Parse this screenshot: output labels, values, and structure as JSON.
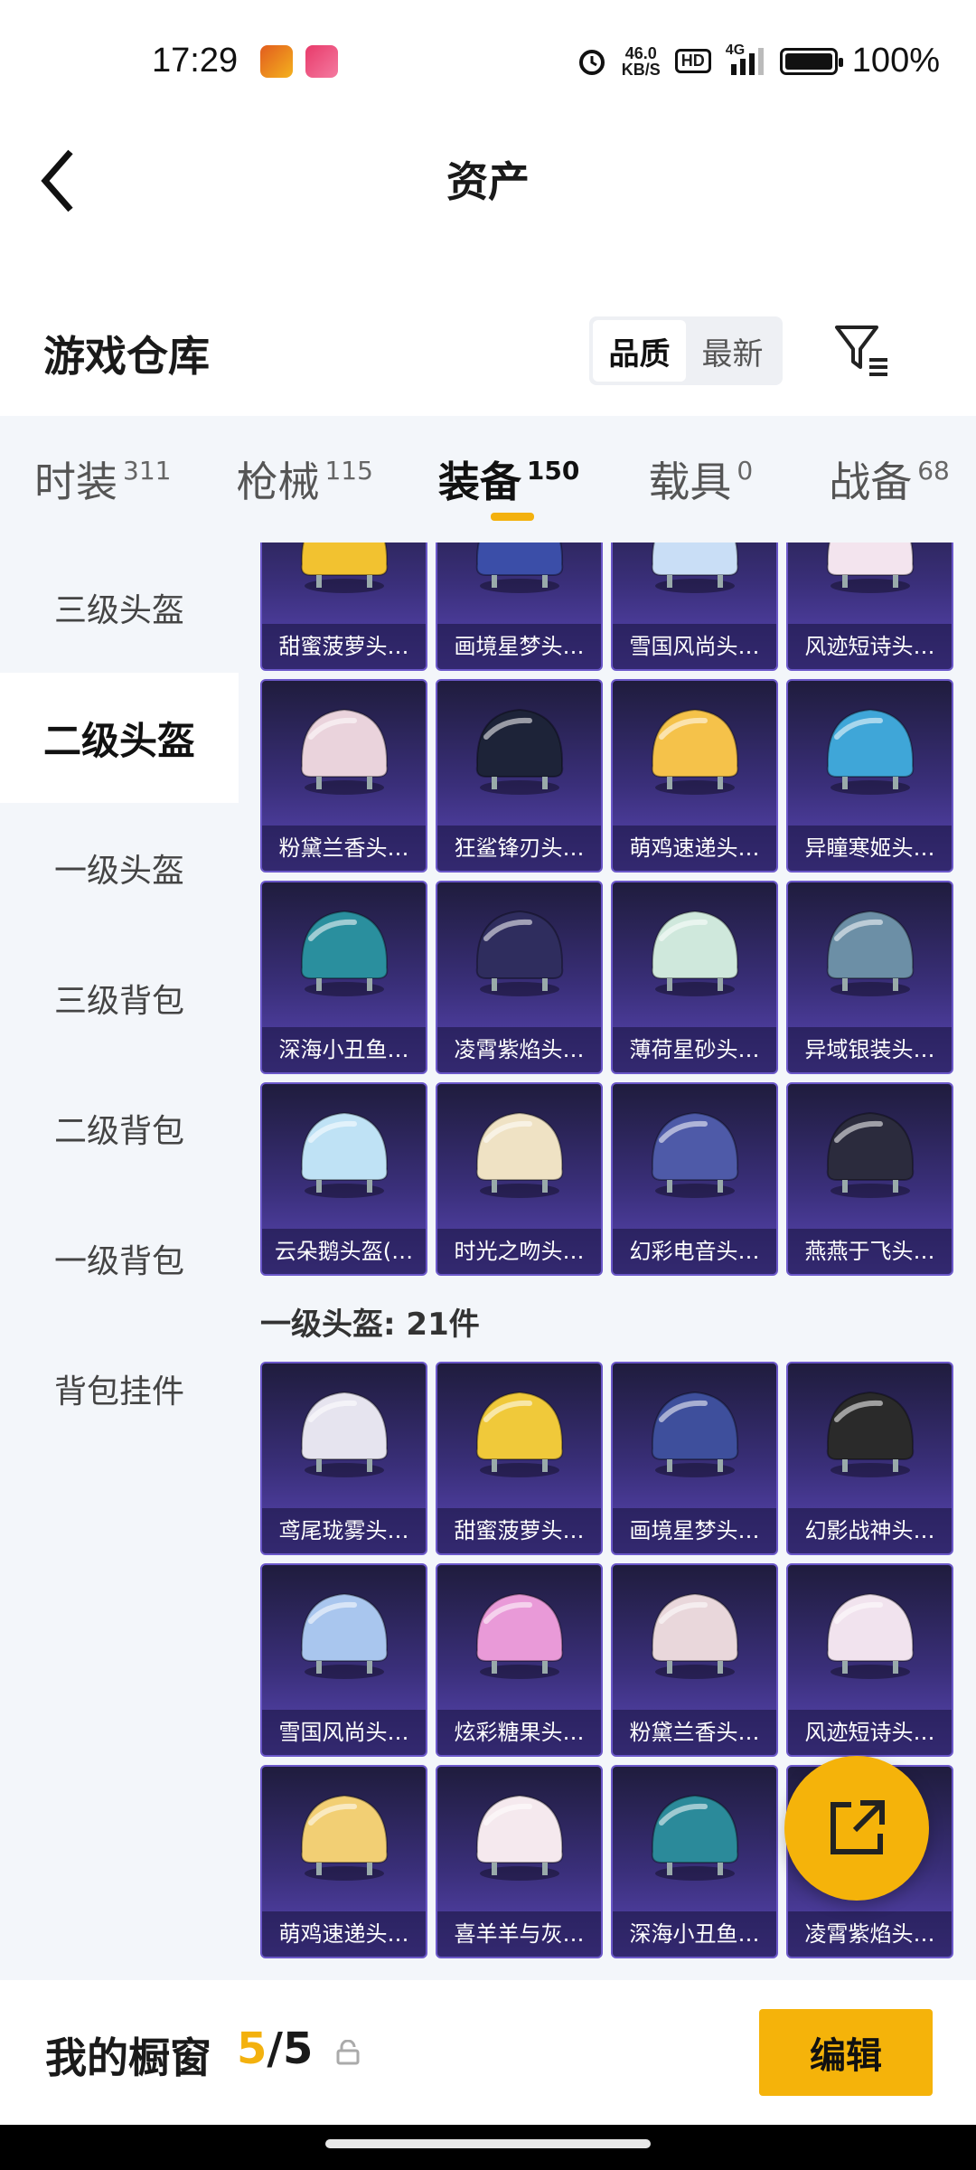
{
  "status": {
    "time": "17:29",
    "speed": "46.0",
    "speed_unit": "KB/S",
    "hd": "HD",
    "net": "4G",
    "battery": "100%"
  },
  "nav": {
    "title": "资产"
  },
  "warehouse": {
    "title": "游戏仓库",
    "sort": [
      "品质",
      "最新"
    ]
  },
  "tabs": [
    {
      "label": "时装",
      "count": "311"
    },
    {
      "label": "枪械",
      "count": "115"
    },
    {
      "label": "装备",
      "count": "150"
    },
    {
      "label": "载具",
      "count": "0"
    },
    {
      "label": "战备",
      "count": "68"
    }
  ],
  "sidebar": [
    "三级头盔",
    "二级头盔",
    "一级头盔",
    "三级背包",
    "二级背包",
    "一级背包",
    "背包挂件"
  ],
  "level2_items": [
    {
      "name": "甜蜜菠萝头…",
      "color": "#f2c230"
    },
    {
      "name": "画境星梦头…",
      "color": "#3b4ea8"
    },
    {
      "name": "雪国风尚头…",
      "color": "#c9def6"
    },
    {
      "name": "风迹短诗头…",
      "color": "#f3e4ee"
    },
    {
      "name": "粉黛兰香头…",
      "color": "#ead3dc"
    },
    {
      "name": "狂鲨锋刃头…",
      "color": "#1d2338"
    },
    {
      "name": "萌鸡速递头…",
      "color": "#f5c24a"
    },
    {
      "name": "异瞳寒姬头…",
      "color": "#3fa6d8"
    },
    {
      "name": "深海小丑鱼…",
      "color": "#2a8f9e"
    },
    {
      "name": "凌霄紫焰头…",
      "color": "#2f2d5e"
    },
    {
      "name": "薄荷星砂头…",
      "color": "#cfe8dc"
    },
    {
      "name": "异域银装头…",
      "color": "#6c8fa6"
    },
    {
      "name": "云朵鹅头盔(…",
      "color": "#bfe2f5"
    },
    {
      "name": "时光之吻头…",
      "color": "#efe2c4"
    },
    {
      "name": "幻彩电音头…",
      "color": "#4e5aa8"
    },
    {
      "name": "燕燕于飞头…",
      "color": "#2b2b3d"
    }
  ],
  "level1_title": "一级头盔: 21件",
  "level1_items": [
    {
      "name": "鸢尾珑雾头…",
      "color": "#e6e4ef"
    },
    {
      "name": "甜蜜菠萝头…",
      "color": "#f0c93a"
    },
    {
      "name": "画境星梦头…",
      "color": "#3e4f9c"
    },
    {
      "name": "幻影战神头…",
      "color": "#2a2a2a"
    },
    {
      "name": "雪国风尚头…",
      "color": "#a9c6ee"
    },
    {
      "name": "炫彩糖果头…",
      "color": "#e99ad8"
    },
    {
      "name": "粉黛兰香头…",
      "color": "#e9d7db"
    },
    {
      "name": "风迹短诗头…",
      "color": "#f1e3ee"
    },
    {
      "name": "萌鸡速递头…",
      "color": "#f2cf74"
    },
    {
      "name": "喜羊羊与灰…",
      "color": "#f5e9ee"
    },
    {
      "name": "深海小丑鱼…",
      "color": "#2b8a9a"
    },
    {
      "name": "凌霄紫焰头…",
      "color": "#2e2a56"
    }
  ],
  "showcase": {
    "label": "我的橱窗",
    "current": "5",
    "total": "/5",
    "edit": "编辑"
  }
}
